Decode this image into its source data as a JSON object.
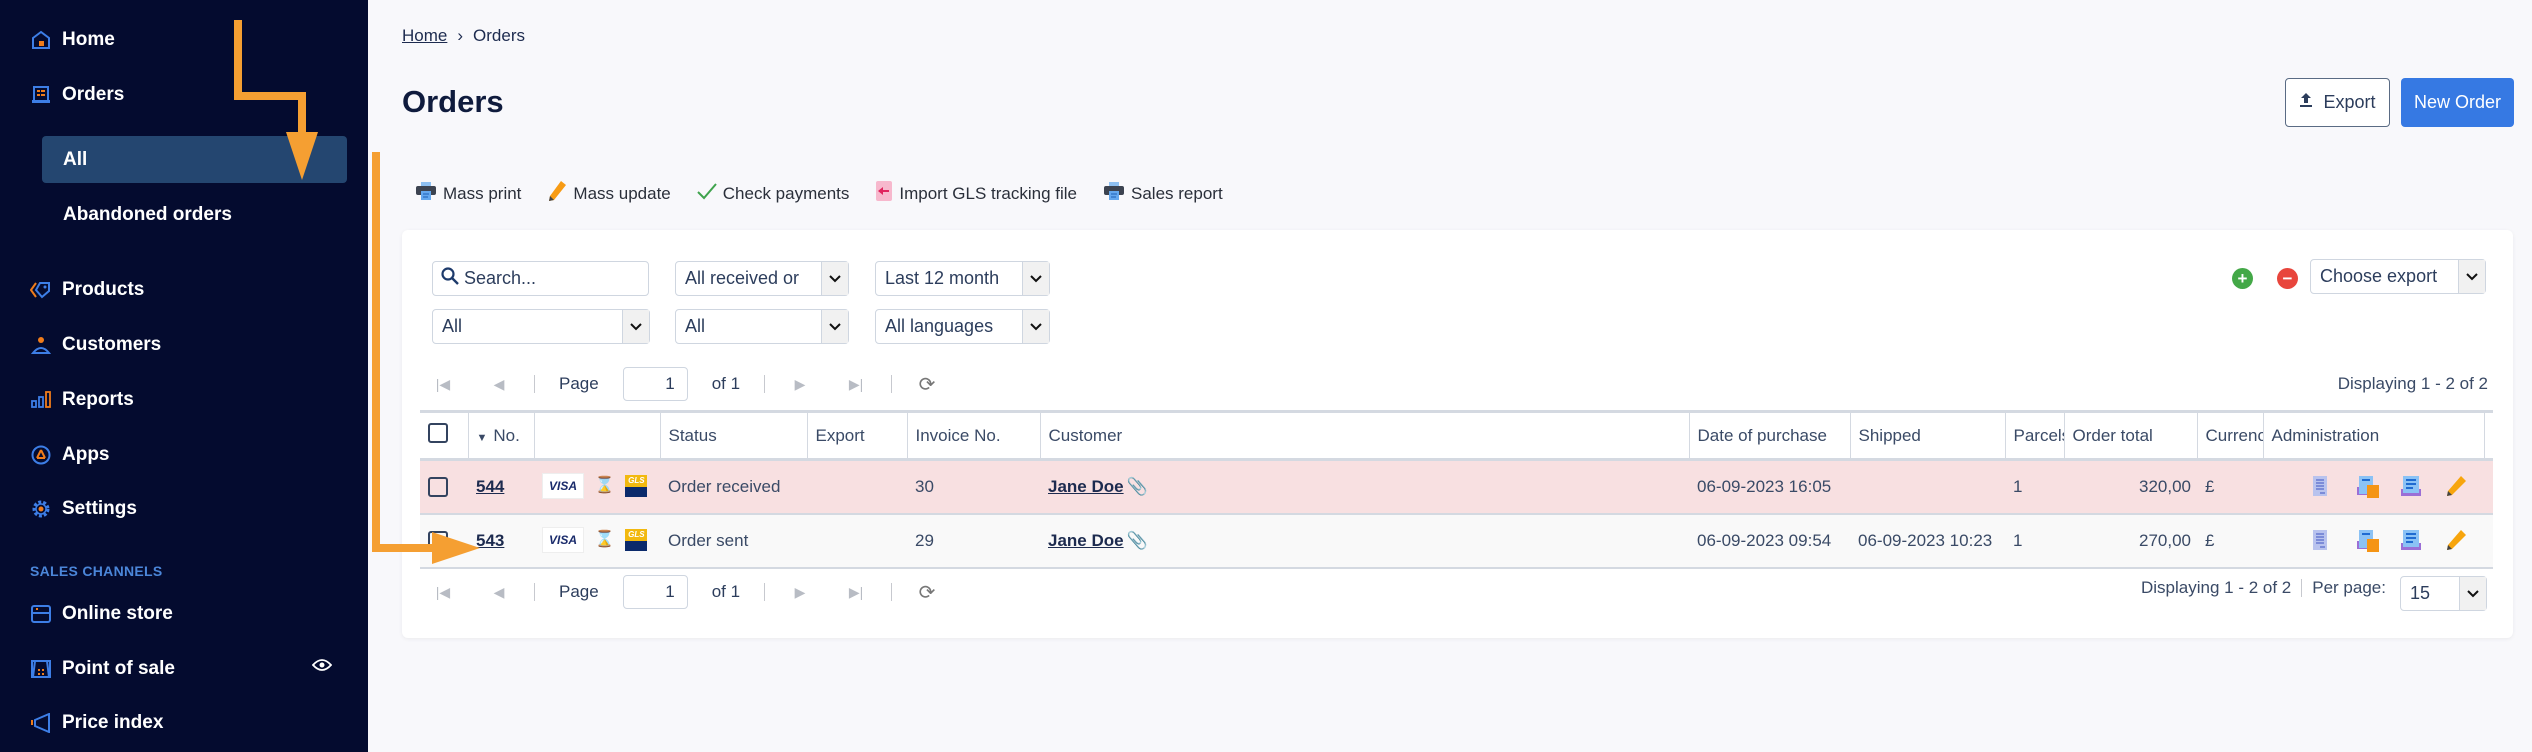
{
  "sidebar": {
    "items": [
      {
        "label": "Home",
        "icon": "home-icon"
      },
      {
        "label": "Orders",
        "icon": "orders-icon"
      },
      {
        "label": "Products",
        "icon": "tag-icon"
      },
      {
        "label": "Customers",
        "icon": "user-icon"
      },
      {
        "label": "Reports",
        "icon": "bar-chart-icon"
      },
      {
        "label": "Apps",
        "icon": "apps-icon"
      },
      {
        "label": "Settings",
        "icon": "gear-icon"
      }
    ],
    "orders_sub": [
      {
        "label": "All",
        "active": true
      },
      {
        "label": "Abandoned orders",
        "active": false
      }
    ],
    "section_label": "SALES CHANNELS",
    "channels": [
      {
        "label": "Online store",
        "icon": "store-icon"
      },
      {
        "label": "Point of sale",
        "icon": "pos-icon",
        "trailing_icon": "eye-icon"
      },
      {
        "label": "Price index",
        "icon": "megaphone-icon"
      }
    ]
  },
  "breadcrumb": {
    "home": "Home",
    "separator": "›",
    "current": "Orders"
  },
  "page": {
    "title": "Orders"
  },
  "header_buttons": {
    "export": "Export",
    "new_order": "New Order"
  },
  "toolbar": [
    {
      "label": "Mass print",
      "icon": "printer-icon"
    },
    {
      "label": "Mass update",
      "icon": "pencil-icon"
    },
    {
      "label": "Check payments",
      "icon": "check-icon"
    },
    {
      "label": "Import GLS tracking file",
      "icon": "import-icon"
    },
    {
      "label": "Sales report",
      "icon": "printer-icon"
    }
  ],
  "filters": {
    "search_placeholder": "Search...",
    "status": "All received or",
    "period": "Last 12 month",
    "filter1": "All",
    "filter2": "All",
    "language": "All languages",
    "choose_export": "Choose export"
  },
  "pager": {
    "page_label": "Page",
    "page": "1",
    "of_label": "of 1",
    "displaying": "Displaying 1 - 2 of 2",
    "per_page_label": "Per page:",
    "per_page": "15"
  },
  "table": {
    "columns": [
      "",
      "No.",
      "",
      "Status",
      "Export",
      "Invoice No.",
      "Customer",
      "Date of purchase",
      "Shipped",
      "Parcels",
      "Order total",
      "Currency",
      "Administration"
    ],
    "rows": [
      {
        "no": "544",
        "status": "Order received",
        "export": "",
        "invoice": "30",
        "customer": "Jane Doe",
        "date": "06-09-2023 16:05",
        "shipped": "",
        "parcels": "1",
        "total": "320,00",
        "currency": "£",
        "highlight": true
      },
      {
        "no": "543",
        "status": "Order sent",
        "export": "",
        "invoice": "29",
        "customer": "Jane Doe",
        "date": "06-09-2023 09:54",
        "shipped": "06-09-2023 10:23",
        "parcels": "1",
        "total": "270,00",
        "currency": "£",
        "highlight": false
      }
    ],
    "payment_label": "VISA",
    "carrier_label": "GLS"
  },
  "colors": {
    "sidebar_bg": "#040b2f",
    "active_bg": "#244670",
    "accent": "#3679e3",
    "annotation": "#f59f32",
    "row_highlight": "#f8e0e1"
  }
}
